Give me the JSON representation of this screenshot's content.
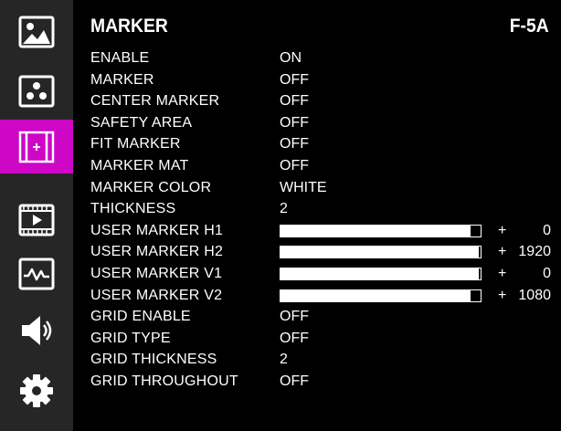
{
  "sidebar": {
    "items": [
      {
        "icon": "picture-icon",
        "active": false
      },
      {
        "icon": "color-dots-icon",
        "active": false
      },
      {
        "icon": "marker-frame-icon",
        "active": true
      },
      {
        "icon": "film-play-icon",
        "active": false
      },
      {
        "icon": "waveform-icon",
        "active": false
      },
      {
        "icon": "speaker-icon",
        "active": false
      },
      {
        "icon": "gear-icon",
        "active": false
      }
    ],
    "active_color": "#ce06c6"
  },
  "header": {
    "title": "MARKER",
    "code": "F-5A"
  },
  "settings": [
    {
      "label": "ENABLE",
      "value": "ON"
    },
    {
      "label": "MARKER",
      "value": "OFF"
    },
    {
      "label": "CENTER MARKER",
      "value": "OFF"
    },
    {
      "label": "SAFETY AREA",
      "value": "OFF"
    },
    {
      "label": "FIT MARKER",
      "value": "OFF"
    },
    {
      "label": "MARKER MAT",
      "value": "OFF"
    },
    {
      "label": "MARKER COLOR",
      "value": "WHITE"
    },
    {
      "label": "THICKNESS",
      "value": "2"
    },
    {
      "label": "USER MARKER H1",
      "sign": "+",
      "number": "0",
      "level": 0.95
    },
    {
      "label": "USER MARKER H2",
      "sign": "+",
      "number": "1920",
      "level": 0.99
    },
    {
      "label": "USER MARKER V1",
      "sign": "+",
      "number": "0",
      "level": 0.99
    },
    {
      "label": "USER MARKER V2",
      "sign": "+",
      "number": "1080",
      "level": 0.95
    },
    {
      "label": "GRID ENABLE",
      "value": "OFF"
    },
    {
      "label": "GRID TYPE",
      "value": "OFF"
    },
    {
      "label": "GRID THICKNESS",
      "value": "2"
    },
    {
      "label": "GRID THROUGHOUT",
      "value": "OFF"
    }
  ]
}
